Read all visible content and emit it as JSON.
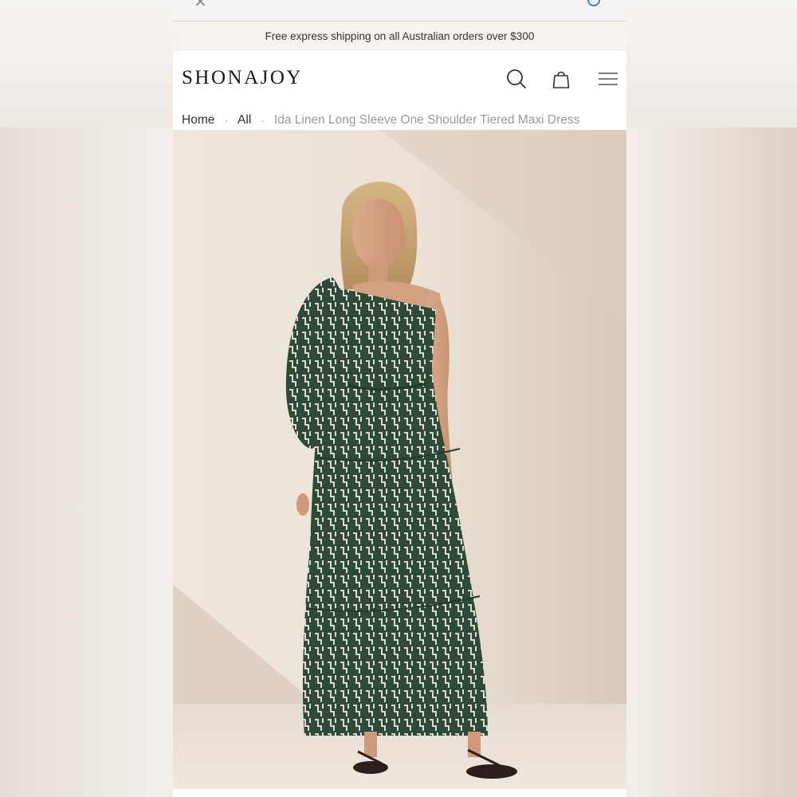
{
  "promo": {
    "text": "Free express shipping on all Australian orders over $300"
  },
  "header": {
    "logo": "SHONAJOY",
    "icons": [
      "search-icon",
      "bag-icon",
      "menu-icon"
    ]
  },
  "breadcrumb": {
    "home": "Home",
    "separator": "·",
    "all": "All",
    "current": "Ida Linen Long Sleeve One Shoulder Tiered Maxi Dress"
  },
  "colors": {
    "promo_bg": "#f7f3ee",
    "hero_bg": "#ece3d9",
    "dress_green": "#2f4a38",
    "text_dark": "#1a1a1a",
    "breadcrumb_muted": "#9a9a9a"
  },
  "hero": {
    "alt_subject": "product-photo"
  }
}
